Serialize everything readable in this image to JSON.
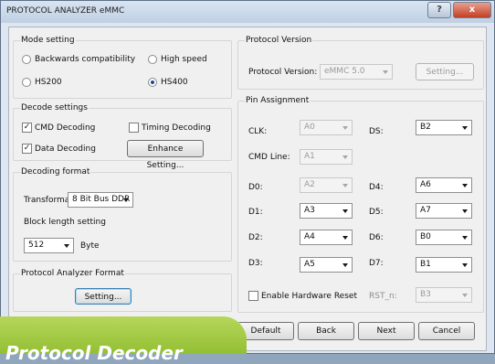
{
  "window": {
    "title": "PROTOCOL ANALYZER eMMC",
    "help_glyph": "?",
    "close_glyph": "x"
  },
  "mode_setting": {
    "label": "Mode setting",
    "options": [
      {
        "label": "Backwards compatibility",
        "selected": false
      },
      {
        "label": "High speed",
        "selected": false
      },
      {
        "label": "HS200",
        "selected": false
      },
      {
        "label": "HS400",
        "selected": true
      }
    ]
  },
  "protocol_version": {
    "label": "Protocol Version",
    "field_label": "Protocol Version:",
    "value": "eMMC 5.0",
    "setting_button": "Setting..."
  },
  "decode_settings": {
    "label": "Decode settings",
    "cmd_decoding": {
      "label": "CMD Decoding",
      "checked": true
    },
    "timing_decoding": {
      "label": "Timing Decoding",
      "checked": false
    },
    "data_decoding": {
      "label": "Data Decoding",
      "checked": true
    },
    "enhance_button": "Enhance Setting..."
  },
  "decoding_format": {
    "label": "Decoding format",
    "transformat_label": "Transformat:",
    "transformat_value": "8 Bit Bus DDR",
    "block_length_label": "Block length setting",
    "block_length_value": "512",
    "unit": "Byte"
  },
  "analyzer_format": {
    "label": "Protocol Analyzer Format",
    "setting_button": "Setting..."
  },
  "pin_assignment": {
    "label": "Pin Assignment",
    "pins": {
      "clk": {
        "label": "CLK:",
        "value": "A0",
        "enabled": false
      },
      "ds": {
        "label": "DS:",
        "value": "B2",
        "enabled": true
      },
      "cmd": {
        "label": "CMD Line:",
        "value": "A1",
        "enabled": false
      },
      "d0": {
        "label": "D0:",
        "value": "A2",
        "enabled": false
      },
      "d4": {
        "label": "D4:",
        "value": "A6",
        "enabled": true
      },
      "d1": {
        "label": "D1:",
        "value": "A3",
        "enabled": true
      },
      "d5": {
        "label": "D5:",
        "value": "A7",
        "enabled": true
      },
      "d2": {
        "label": "D2:",
        "value": "A4",
        "enabled": true
      },
      "d6": {
        "label": "D6:",
        "value": "B0",
        "enabled": true
      },
      "d3": {
        "label": "D3:",
        "value": "A5",
        "enabled": true
      },
      "d7": {
        "label": "D7:",
        "value": "B1",
        "enabled": true
      },
      "rst": {
        "label": "RST_n:",
        "value": "B3",
        "enabled": false
      }
    },
    "hardware_reset": {
      "label": "Enable Hardware Reset",
      "checked": false
    }
  },
  "buttons": {
    "default": "Default",
    "back": "Back",
    "next": "Next",
    "cancel": "Cancel"
  },
  "banner": {
    "text": "Protocol Decoder"
  }
}
